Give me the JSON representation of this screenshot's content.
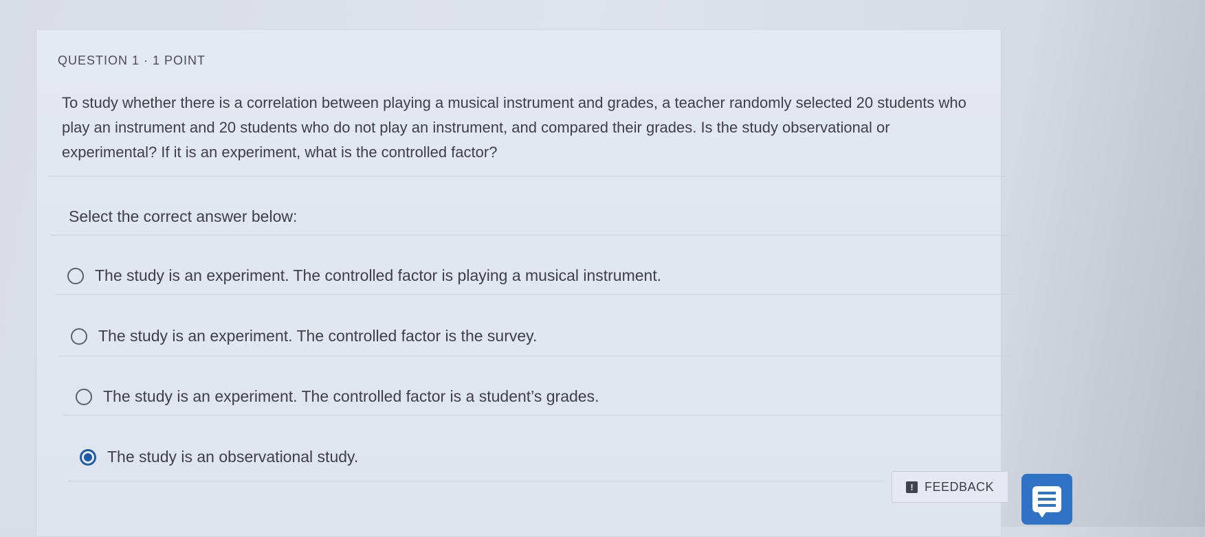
{
  "question": {
    "header": "QUESTION 1 · 1 POINT",
    "text": "To study whether there is a correlation between playing a musical instrument and grades, a teacher randomly selected 20 students who play an instrument and 20 students who do not play an instrument, and compared their grades. Is the study observational or experimental? If it is an experiment, what is the controlled factor?",
    "prompt": "Select the correct answer below:"
  },
  "options": [
    {
      "label": "The study is an experiment. The controlled factor is playing a musical instrument.",
      "selected": false
    },
    {
      "label": "The study is an experiment. The controlled factor is the survey.",
      "selected": false
    },
    {
      "label": "The study is an experiment. The controlled factor is a student’s grades.",
      "selected": false
    },
    {
      "label": "The study is an observational study.",
      "selected": true
    }
  ],
  "feedback": {
    "label": "FEEDBACK",
    "icon": "exclamation-box-icon"
  },
  "chat": {
    "icon": "chat-bubble-icon"
  },
  "colors": {
    "accent": "#1f5aa6",
    "chat_button": "#2f74c4"
  }
}
